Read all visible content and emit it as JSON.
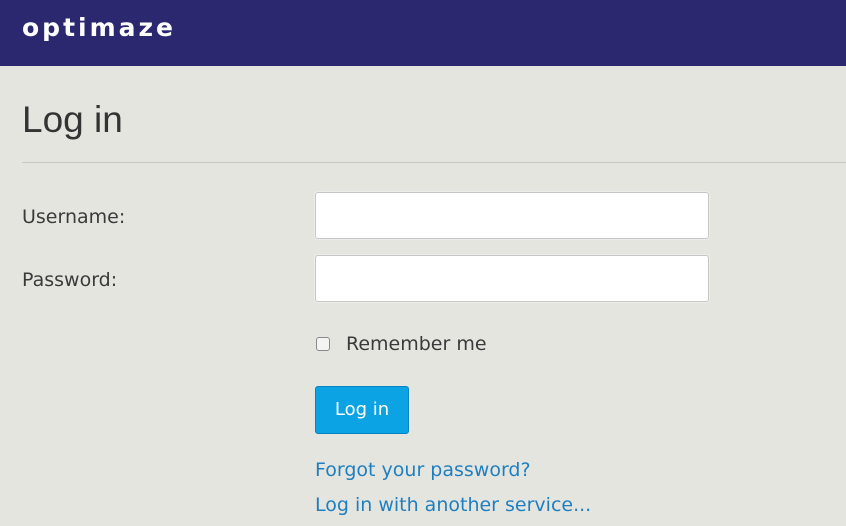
{
  "header": {
    "logo_text": "optimaze"
  },
  "page": {
    "title": "Log in"
  },
  "form": {
    "username_label": "Username:",
    "username_value": "",
    "password_label": "Password:",
    "password_value": "",
    "remember_label": "Remember me",
    "remember_checked": false,
    "submit_label": "Log in"
  },
  "links": {
    "forgot_password": "Forgot your password?",
    "other_service": "Log in with another service..."
  },
  "colors": {
    "header_background": "#2c2870",
    "page_background": "#e5e5e0",
    "button_background": "#0ba3e4",
    "link_color": "#1e7fc0"
  }
}
